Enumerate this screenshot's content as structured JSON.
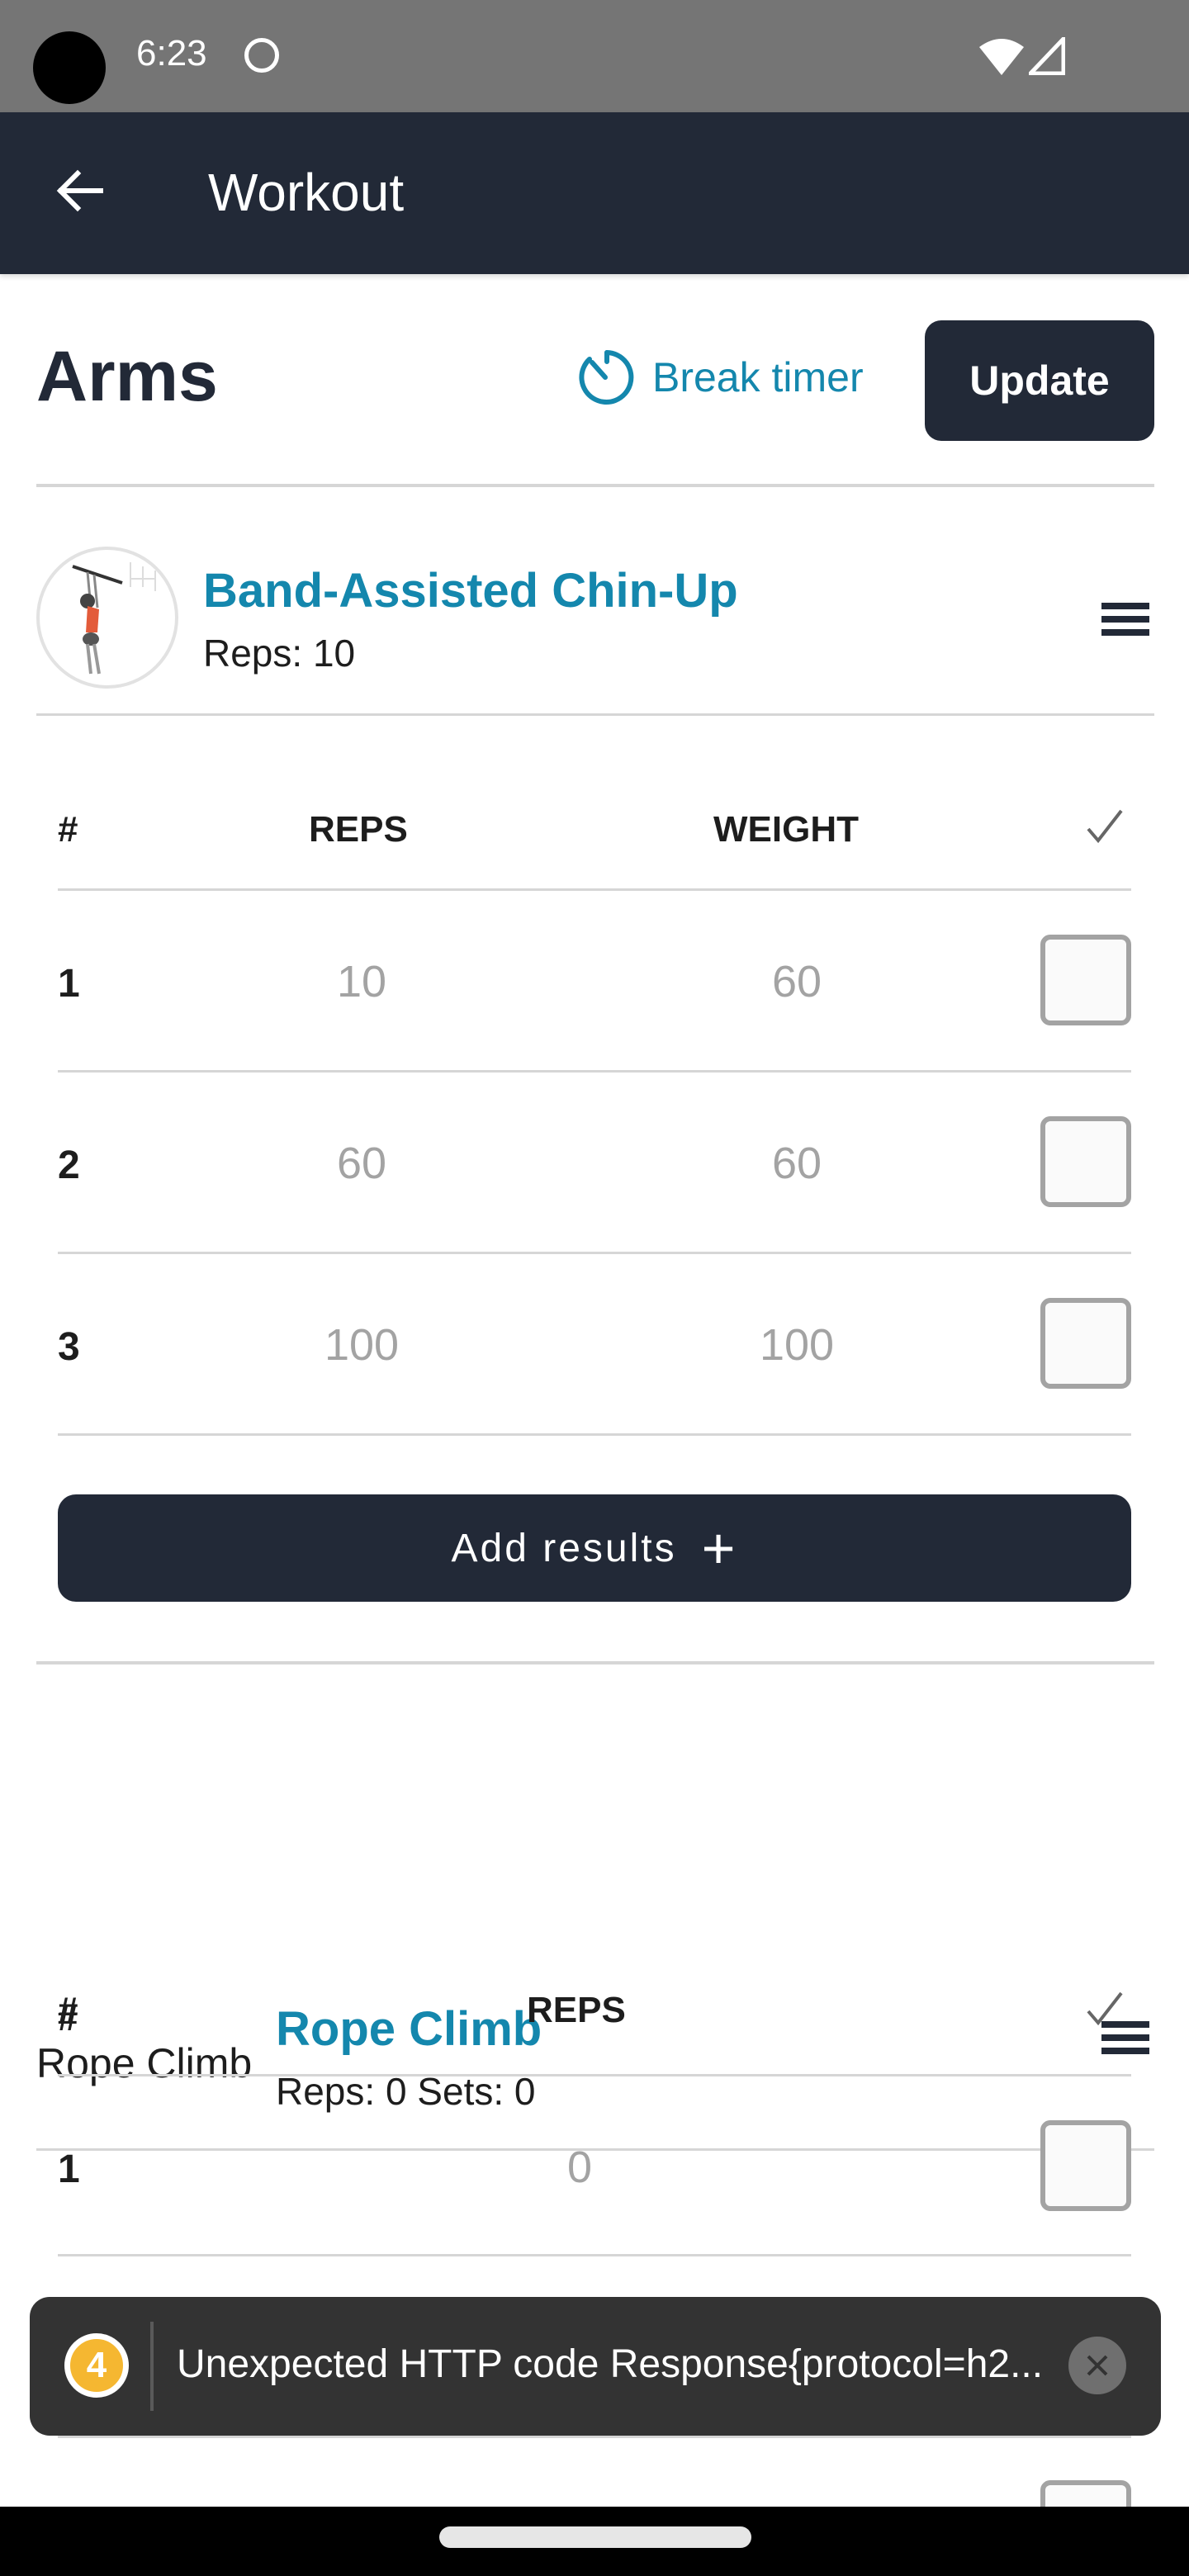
{
  "status_bar": {
    "time": "6:23",
    "icons": [
      "camera-cutout",
      "face-icon",
      "wifi-icon",
      "signal-icon"
    ]
  },
  "app_bar": {
    "title": "Workout",
    "back_icon": "arrow-left-icon"
  },
  "header": {
    "title": "Arms",
    "break_timer_label": "Break timer",
    "update_label": "Update",
    "accent_color": "#1487ad",
    "primary_color": "#222937"
  },
  "exercises": [
    {
      "name": "Band-Assisted Chin-Up",
      "subtitle": "Reps: 10",
      "columns": [
        "#",
        "REPS",
        "WEIGHT"
      ],
      "rows": [
        {
          "num": "1",
          "reps": "10",
          "weight": "60",
          "done": false
        },
        {
          "num": "2",
          "reps": "60",
          "weight": "60",
          "done": false
        },
        {
          "num": "3",
          "reps": "100",
          "weight": "100",
          "done": false
        }
      ],
      "add_button_label": "Add results",
      "add_icon": "+"
    },
    {
      "image_alt": "Rope Climb",
      "name": "Rope Climb",
      "subtitle": "Reps: 0 Sets: 0",
      "columns": [
        "#",
        "REPS"
      ],
      "rows": [
        {
          "num": "1",
          "reps": "0",
          "done": false
        }
      ]
    }
  ],
  "toast": {
    "badge": "4",
    "message": "Unexpected HTTP code Response{protocol=h2..."
  }
}
